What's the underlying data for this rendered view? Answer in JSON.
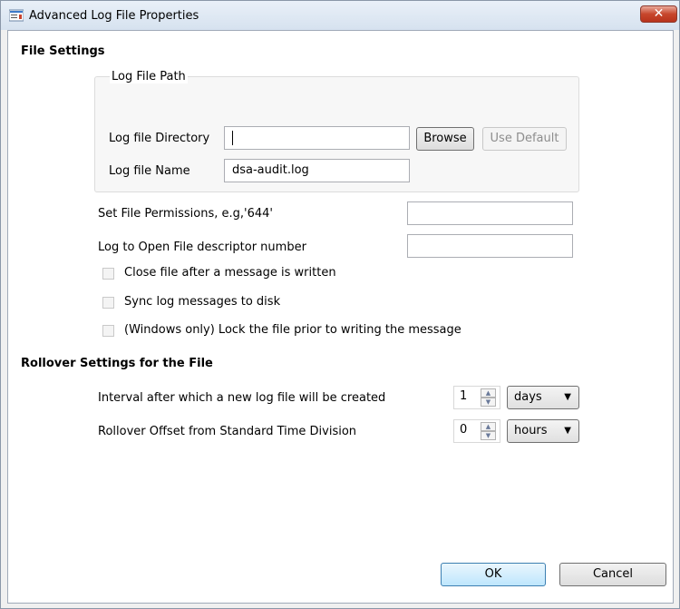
{
  "window": {
    "title": "Advanced Log File Properties",
    "close_glyph": "✕"
  },
  "file_settings": {
    "heading": "File Settings",
    "log_file_path": {
      "group_title": "Log File Path",
      "directory_label": "Log file Directory",
      "directory_value": "",
      "browse_label": "Browse",
      "use_default_label": "Use Default",
      "name_label": "Log file Name",
      "name_value": "dsa-audit.log"
    },
    "permissions_label": "Set File Permissions, e.g,'644'",
    "permissions_value": "",
    "descriptor_label": "Log to Open File descriptor number",
    "descriptor_value": "",
    "checkboxes": [
      {
        "label": "Close file after a message is written",
        "checked": false
      },
      {
        "label": "Sync log messages to disk",
        "checked": false
      },
      {
        "label": "(Windows only) Lock the file prior to writing the message",
        "checked": false
      }
    ]
  },
  "rollover": {
    "heading": "Rollover Settings for the File",
    "interval_label": "Interval after which a new log file will be created",
    "interval_value": "1",
    "interval_unit": "days",
    "offset_label": "Rollover Offset from Standard Time Division",
    "offset_value": "0",
    "offset_unit": "hours"
  },
  "buttons": {
    "ok": "OK",
    "cancel": "Cancel"
  },
  "icons": {
    "window": "window-properties-icon",
    "spin_up": "▲",
    "spin_down": "▼",
    "dropdown": "▼"
  }
}
